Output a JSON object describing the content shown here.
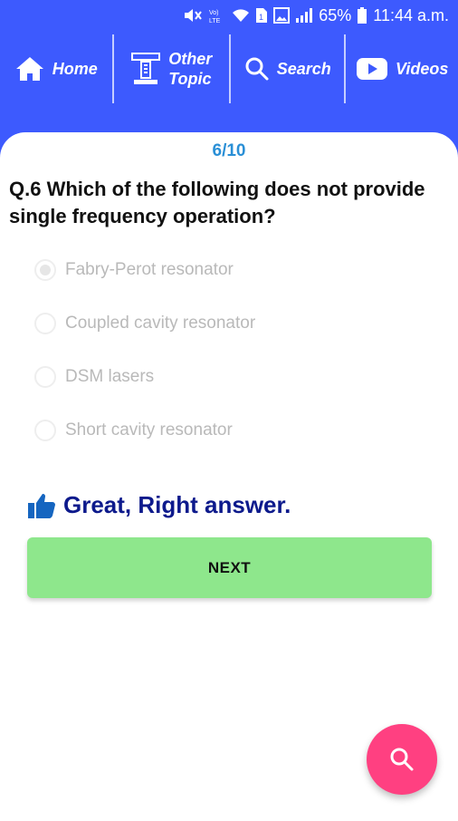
{
  "status_bar": {
    "battery": "65%",
    "time": "11:44 a.m.",
    "icons": [
      "mute-icon",
      "volte-icon",
      "wifi-icon",
      "sim-icon",
      "image-icon",
      "signal-icon",
      "battery-icon"
    ]
  },
  "nav": {
    "home_label": "Home",
    "other_topic_line1": "Other",
    "other_topic_line2": "Topic",
    "search_label": "Search",
    "videos_label": "Videos"
  },
  "quiz": {
    "counter": "6/10",
    "question": "Q.6 Which of the following does not provide single frequency operation?",
    "options": [
      {
        "label": "Fabry-Perot resonator",
        "selected": true
      },
      {
        "label": "Coupled cavity resonator",
        "selected": false
      },
      {
        "label": "DSM lasers",
        "selected": false
      },
      {
        "label": "Short cavity resonator",
        "selected": false
      }
    ],
    "feedback": "Great, Right answer.",
    "next_label": "NEXT"
  },
  "colors": {
    "header_bg": "#3d5afe",
    "counter": "#2a8fd6",
    "feedback_text": "#0d1a8c",
    "next_button": "#8ee78c",
    "fab": "#ff4081"
  }
}
